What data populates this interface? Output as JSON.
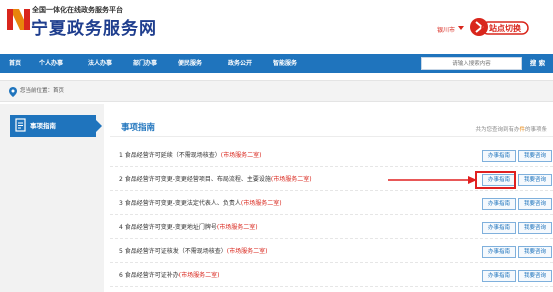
{
  "header": {
    "logo_subtitle": "全国一体化在线政务服务平台",
    "logo_title": "宁夏政务服务网",
    "city": "银川市",
    "switch_badge": "站点切换",
    "brand_color": "#1f3e8e",
    "accent_color": "#d9261c"
  },
  "nav": {
    "items": [
      {
        "label": "首页"
      },
      {
        "label": "个人办事"
      },
      {
        "label": "法人办事"
      },
      {
        "label": "部门办事"
      },
      {
        "label": "便民服务"
      },
      {
        "label": "政务公开"
      },
      {
        "label": "智能服务"
      }
    ],
    "search_placeholder": "请输入搜索内容",
    "search_button": "搜 索",
    "nav_color": "#1f74bd"
  },
  "breadcrumb": {
    "label": "您当前位置：",
    "current": "首页"
  },
  "sidebar": {
    "active_tab": "事项指南"
  },
  "content": {
    "title": "事项指南",
    "count_prefix": "共为您查询到有办",
    "count_highlight": "件",
    "count_suffix": "的事项条",
    "rows": [
      {
        "text": "1  食品经营许可延续（不需现场核查）",
        "place": "(市场服务二室)",
        "guide": "办事指南",
        "consult": "我要咨询"
      },
      {
        "text": "2  食品经营许可变更-变更经营项目、布局流程、主要设施",
        "place": "(市场服务二室)",
        "guide": "办事指南",
        "consult": "我要咨询"
      },
      {
        "text": "3  食品经营许可变更-变更法定代表人、负责人",
        "place": "(市场服务二室)",
        "guide": "办事指南",
        "consult": "我要咨询"
      },
      {
        "text": "4  食品经营许可变更-变更地址门牌号",
        "place": "(市场服务二室)",
        "guide": "办事指南",
        "consult": "我要咨询"
      },
      {
        "text": "5  食品经营许可证核发（不需现场核查）",
        "place": "(市场服务二室)",
        "guide": "办事指南",
        "consult": "我要咨询"
      },
      {
        "text": "6  食品经营许可证补办",
        "place": "(市场服务二室)",
        "guide": "办事指南",
        "consult": "我要咨询"
      }
    ]
  }
}
